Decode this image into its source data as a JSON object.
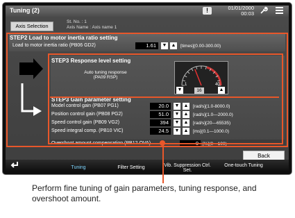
{
  "header": {
    "title": "Tuning (2)",
    "warning_symbol": "!",
    "date": "01/01/2000",
    "time": "00:03"
  },
  "axis": {
    "button_label": "Axis Selection",
    "station_label": "St. No. : 1",
    "axis_name_label": "Axis Name : Axis name 1"
  },
  "step2": {
    "title": "STEP2 Load to motor inertia ratio setting",
    "param_label": "Load to motor inertia ratio (PB06 GD2)",
    "value": "1.61",
    "unit": "[times](0.00-300.00)"
  },
  "step3_response": {
    "title": "STEP3 Response level setting",
    "param_line1": "Auto tuning response",
    "param_line2": "(PA09 RSP)",
    "gauge_min": "1",
    "gauge_max": "40",
    "gauge_value": "16",
    "gauge_level_fraction": 0.38
  },
  "step3_gain": {
    "title": "STEP3 Gain parameter setting",
    "rows": [
      {
        "label": "Model control gain (PB07 PG1)",
        "value": "20.0",
        "unit": "[rad/s](1.0-8000.0)"
      },
      {
        "label": "Position control gain (PB08 PG2)",
        "value": "51.0",
        "unit": "[rad/s](1.0—2000.0)"
      },
      {
        "label": "Speed control gain (PB09 VG2)",
        "value": "394",
        "unit": "[rad/s](20—65535)"
      },
      {
        "label": "Speed integral comp. (PB10 VIC)",
        "value": "24.5",
        "unit": "[ms](0.1—1000.0)"
      }
    ]
  },
  "overshoot": {
    "label": "Overshoot amount compensation (PB12 OVA)",
    "value": "0",
    "unit": "[%](0—100)"
  },
  "back_label": "Back",
  "tabs": [
    {
      "label": "Tuning",
      "active": true
    },
    {
      "label": "Filter Setting",
      "active": false
    },
    {
      "label": "Vib. Suppression Ctrl. Set.",
      "active": false
    },
    {
      "label": "One-touch Tuning",
      "active": false
    }
  ],
  "icons": {
    "warning": "warning-icon",
    "settings": "wrench-icon",
    "menu": "menu-icon",
    "return": "return-icon",
    "up": "up-arrow-icon",
    "down": "down-arrow-icon"
  },
  "colors": {
    "highlight": "#e8572a",
    "active_tab": "#7fd6ff"
  },
  "caption": "Perform fine tuning of gain parameters, tuning response, and overshoot amount."
}
